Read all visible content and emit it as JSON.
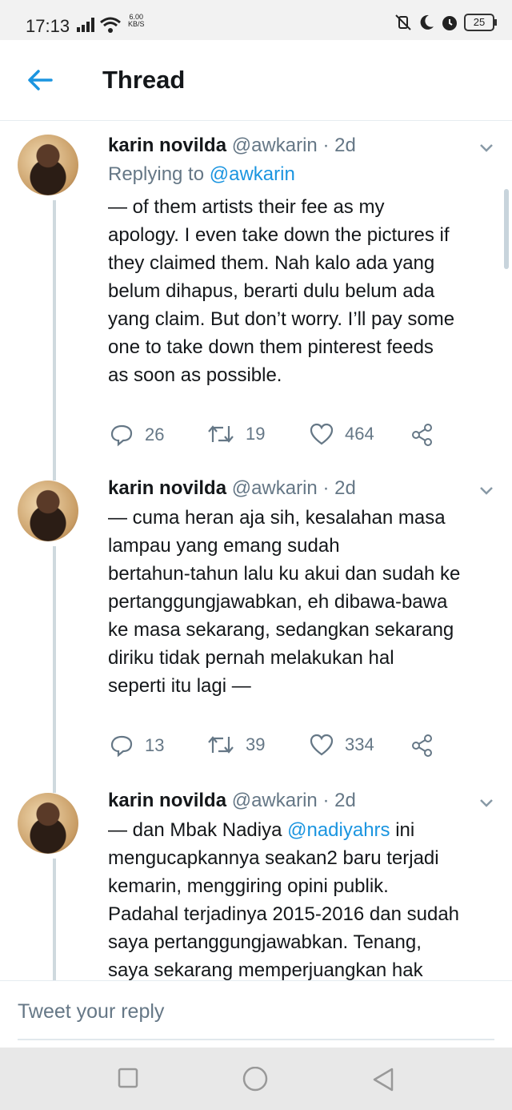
{
  "status_bar": {
    "time": "17:13",
    "net_speed_value": "6.00",
    "net_speed_unit": "KB/S",
    "battery": "25"
  },
  "header": {
    "title": "Thread",
    "back_icon": "arrow-left-icon",
    "accent_color": "#1b95e0"
  },
  "tweets": [
    {
      "name": "karin novilda",
      "handle": "@awkarin",
      "time": "· 2d",
      "replying_prefix": "Replying to",
      "replying_handle": "@awkarin",
      "lines": [
        "— of them artists their fee as my",
        "apology. I even take down the pictures if",
        "they claimed them. Nah kalo ada yang",
        "belum dihapus, berarti dulu belum ada",
        "yang claim. But don’t worry. I’ll pay some",
        "one to take down them pinterest feeds",
        "as soon as possible."
      ],
      "replies": "26",
      "retweets": "19",
      "likes": "464"
    },
    {
      "name": "karin novilda",
      "handle": "@awkarin",
      "time": "· 2d",
      "lines": [
        "— cuma heran aja sih, kesalahan masa",
        "lampau yang emang sudah",
        "bertahun-tahun lalu ku akui dan sudah ke",
        "pertanggungjawabkan, eh dibawa-bawa",
        "ke masa sekarang, sedangkan sekarang",
        "diriku tidak pernah melakukan hal",
        "seperti itu lagi —"
      ],
      "replies": "13",
      "retweets": "39",
      "likes": "334"
    },
    {
      "name": "karin novilda",
      "handle": "@awkarin",
      "time": "· 2d",
      "line1_prefix": "— dan Mbak Nadiya ",
      "line1_mention": "@nadiyahrs",
      "line1_suffix": " ini",
      "lines": [
        "mengucapkannya seakan2 baru terjadi",
        "kemarin, menggiring opini publik.",
        "Padahal terjadinya 2015-2016 dan sudah",
        "saya pertanggungjawabkan. Tenang,",
        "saya sekarang memperjuangkan hak"
      ]
    }
  ],
  "reply_bar": {
    "placeholder": "Tweet your reply"
  }
}
